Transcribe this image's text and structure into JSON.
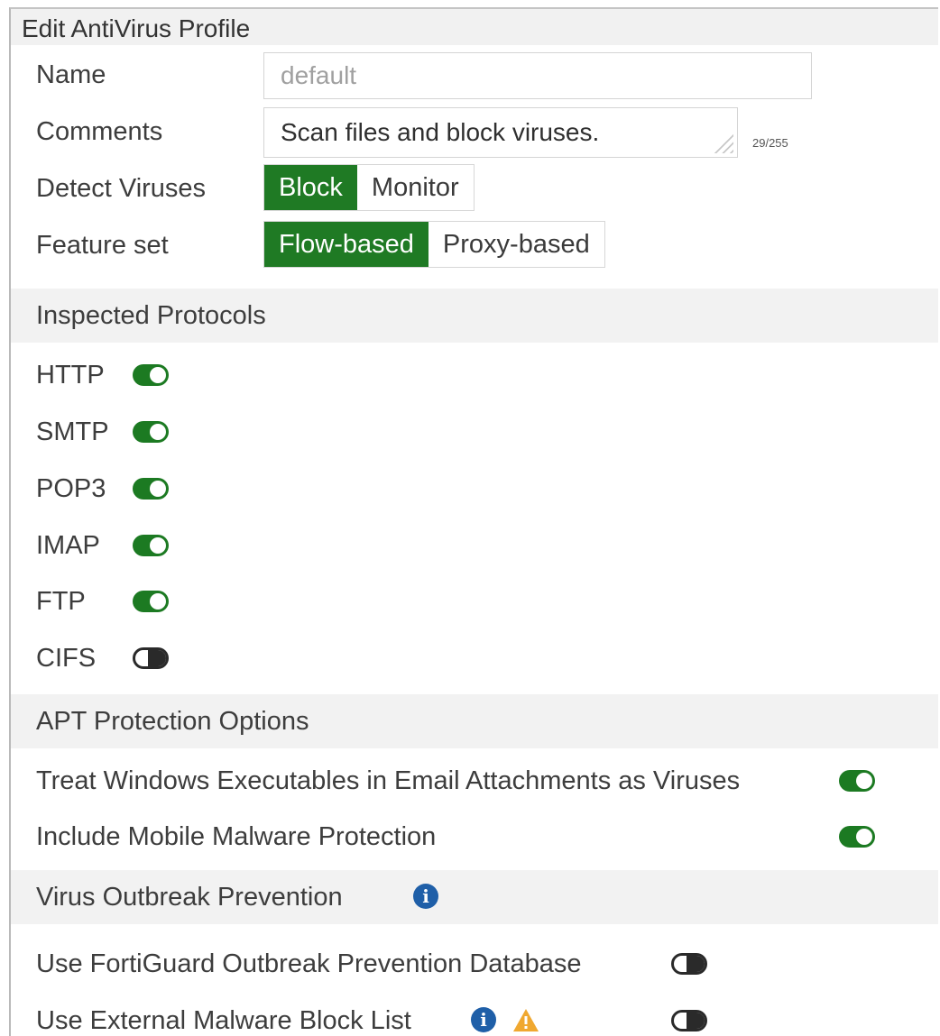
{
  "dialog": {
    "title": "Edit AntiVirus Profile"
  },
  "form": {
    "name_label": "Name",
    "name_value": "default",
    "comments_label": "Comments",
    "comments_value": "Scan files and block viruses.",
    "comments_counter": "29/255",
    "detect_label": "Detect Viruses",
    "detect_options": [
      "Block",
      "Monitor"
    ],
    "detect_selected": "Block",
    "feature_label": "Feature set",
    "feature_options": [
      "Flow-based",
      "Proxy-based"
    ],
    "feature_selected": "Flow-based"
  },
  "inspected": {
    "header": "Inspected Protocols",
    "protocols": [
      {
        "label": "HTTP",
        "enabled": true
      },
      {
        "label": "SMTP",
        "enabled": true
      },
      {
        "label": "POP3",
        "enabled": true
      },
      {
        "label": "IMAP",
        "enabled": true
      },
      {
        "label": "FTP",
        "enabled": true
      },
      {
        "label": "CIFS",
        "enabled": false
      }
    ]
  },
  "apt": {
    "header": "APT Protection Options",
    "options": [
      {
        "label": "Treat Windows Executables in Email Attachments as Viruses",
        "enabled": true
      },
      {
        "label": "Include Mobile Malware Protection",
        "enabled": true
      }
    ]
  },
  "outbreak": {
    "header": "Virus Outbreak Prevention",
    "header_icon": "info-icon",
    "options": [
      {
        "label": "Use FortiGuard Outbreak Prevention Database",
        "enabled": false
      },
      {
        "label": "Use External Malware Block List",
        "enabled": false,
        "icons": [
          "info-icon",
          "warning-icon"
        ]
      }
    ]
  },
  "colors": {
    "accent_green": "#1f7a24",
    "info_blue": "#1f5fa8",
    "warning_orange": "#f0a830",
    "section_bg": "#f2f2f2"
  }
}
